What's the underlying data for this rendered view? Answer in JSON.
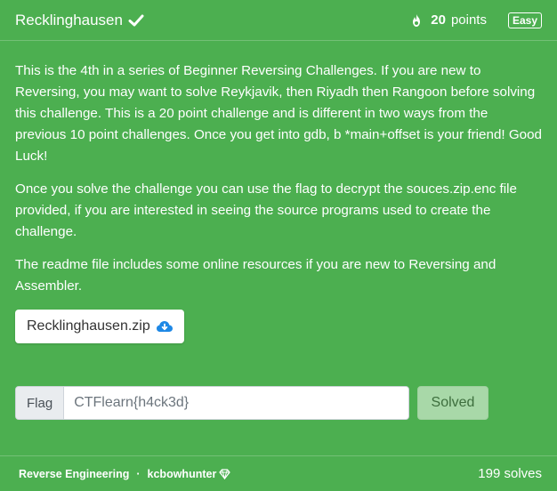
{
  "header": {
    "title": "Recklinghausen",
    "points_value": "20",
    "points_label": "points",
    "difficulty": "Easy"
  },
  "description": {
    "paragraphs": [
      "This is the 4th in a series of Beginner Reversing Challenges. If you are new to Reversing, you may want to solve Reykjavik, then Riyadh then Rangoon before solving this challenge. This is a 20 point challenge and is different in two ways from the previous 10 point challenges. Once you get into gdb, b *main+offset is your friend! Good Luck!",
      "Once you solve the challenge you can use the flag to decrypt the souces.zip.enc file provided, if you are interested in seeing the source programs used to create the challenge.",
      "The readme file includes some online resources if you are new to Reversing and Assembler."
    ]
  },
  "attachment": {
    "filename": "Recklinghausen.zip",
    "icon": "cloud-download-icon"
  },
  "flag_form": {
    "addon_label": "Flag",
    "value": "CTFlearn{h4ck3d}",
    "submit_label": "Solved"
  },
  "footer": {
    "category": "Reverse Engineering",
    "separator": "·",
    "author": "kcbowhunter",
    "solves": "199 solves"
  },
  "colors": {
    "card_background": "#4caf50",
    "solved_button": "#a8d8a8",
    "accent_blue": "#1e88e5"
  }
}
